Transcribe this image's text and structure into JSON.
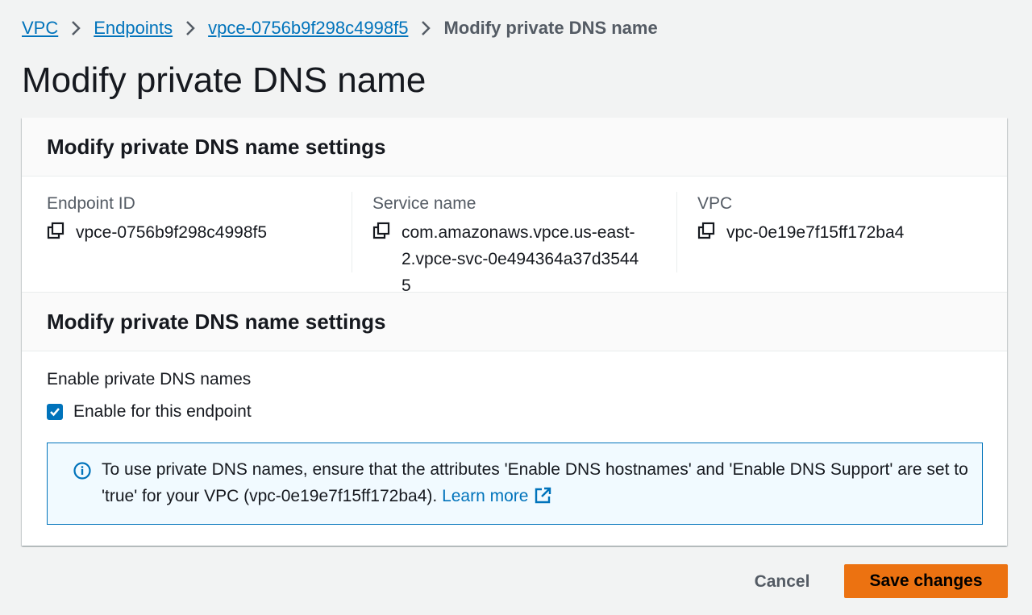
{
  "breadcrumb": {
    "items": [
      {
        "label": "VPC"
      },
      {
        "label": "Endpoints"
      },
      {
        "label": "vpce-0756b9f298c4998f5"
      }
    ],
    "current": "Modify private DNS name"
  },
  "page": {
    "title": "Modify private DNS name"
  },
  "details_section": {
    "title": "Modify private DNS name settings",
    "fields": [
      {
        "label": "Endpoint ID",
        "value": "vpce-0756b9f298c4998f5"
      },
      {
        "label": "Service name",
        "value": "com.amazonaws.vpce.us-east-2.vpce-svc-0e494364a37d35445"
      },
      {
        "label": "VPC",
        "value": "vpc-0e19e7f15ff172ba4"
      }
    ]
  },
  "dns_section": {
    "title": "Modify private DNS name settings",
    "enable_label": "Enable private DNS names",
    "checkbox": {
      "label": "Enable for this endpoint",
      "checked": true
    },
    "alert": {
      "text": "To use private DNS names, ensure that the attributes 'Enable DNS hostnames' and 'Enable DNS Support' are set to 'true' for your VPC (vpc-0e19e7f15ff172ba4).",
      "link_label": "Learn more"
    }
  },
  "actions": {
    "cancel_label": "Cancel",
    "save_label": "Save changes"
  },
  "icons": {
    "breadcrumb_separator": "chevron-right-icon",
    "copy": "copy-icon",
    "info": "info-icon",
    "external_link": "external-link-icon",
    "check": "check-icon"
  },
  "colors": {
    "link": "#0073bb",
    "primary_button": "#ec7211",
    "background": "#f2f3f3",
    "alert_background": "#f1faff"
  }
}
